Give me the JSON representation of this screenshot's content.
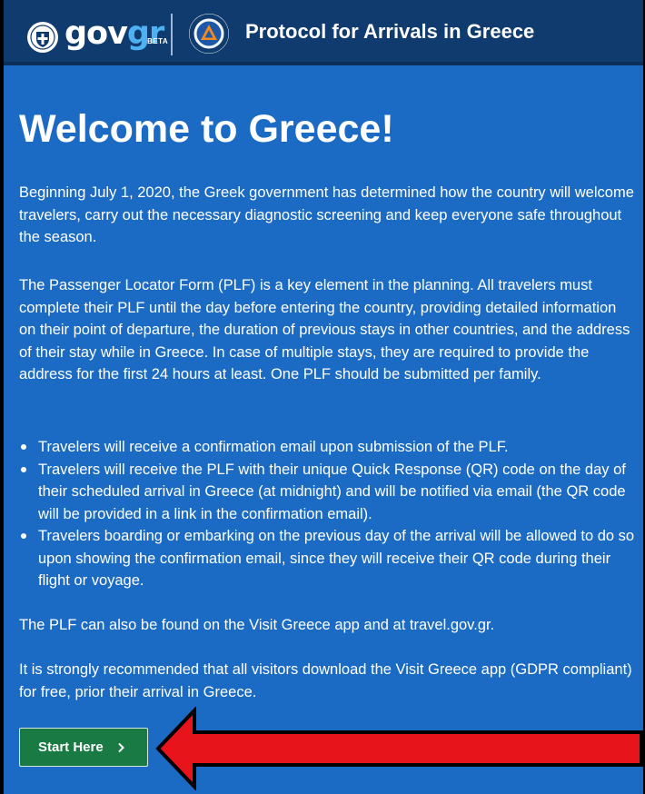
{
  "header": {
    "logo": {
      "gov": "gov",
      "gr": "gr",
      "beta": "BETA"
    },
    "title": "Protocol for Arrivals in Greece",
    "icons": [
      "greek-emblem-icon",
      "civil-protection-icon"
    ]
  },
  "main": {
    "title": "Welcome to Greece!",
    "intro": "Beginning July 1, 2020, the Greek government has determined how the country will welcome travelers, carry out the necessary diagnostic screening and keep everyone safe throughout the season.",
    "plf_text": "The Passenger Locator Form (PLF) is a key element in the planning. All travelers must complete their PLF until the day before entering the country, providing detailed information on their point of departure, the duration of previous stays in other countries, and the address of their stay while in Greece. In case of multiple stays, they are required to provide the address for the first 24 hours at least. One PLF should be submitted per family.",
    "bullets": [
      "Travelers will receive a confirmation email upon submission of the PLF.",
      "Travelers will receive the PLF with their unique Quick Response (QR) code on the day of their scheduled arrival in Greece (at midnight) and will be notified via email (the QR code will be provided in a link in the confirmation email).",
      "Travelers boarding or embarking on the previous day of the arrival will be allowed to do so upon showing the confirmation email, since they will receive their QR code during their flight or voyage."
    ],
    "app_text": "The PLF can also be found on the Visit Greece app and at travel.gov.gr.",
    "recommend_text": "It is strongly recommended that all visitors download the Visit Greece app (GDPR compliant) for free, prior their arrival in Greece.",
    "start_button": "Start Here"
  },
  "colors": {
    "page_background": "#1b6bc4",
    "header_background": "#0f3b6e",
    "logo_accent": "#4fb0f2",
    "button_background": "#1a7a43",
    "annotation_arrow": "#e8141b"
  }
}
